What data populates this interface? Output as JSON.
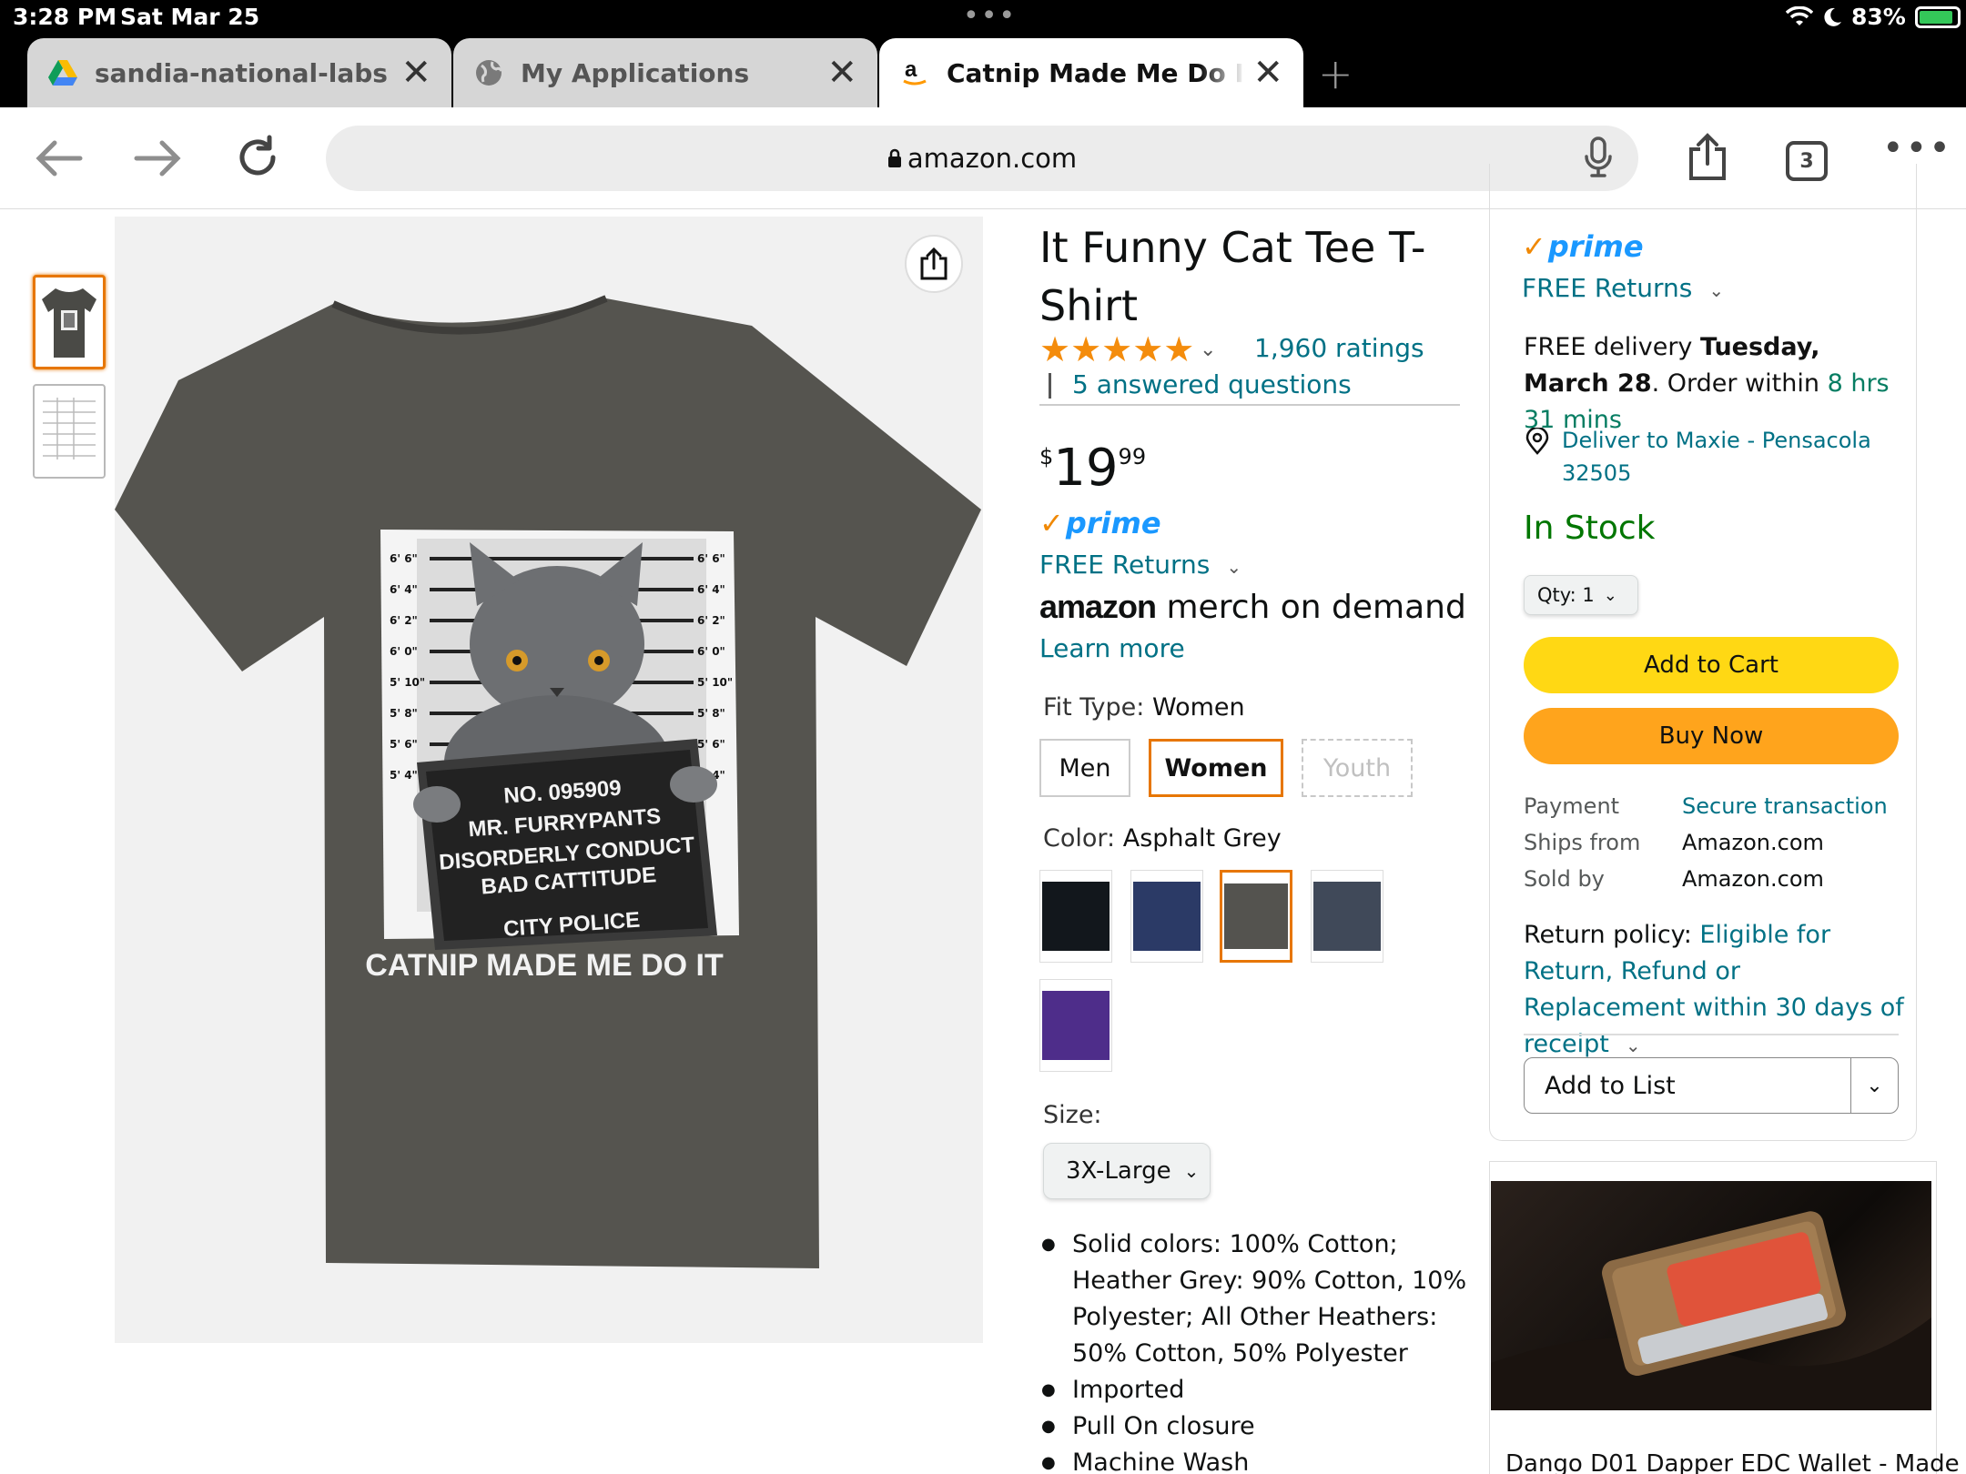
{
  "status_bar": {
    "time": "3:28 PM",
    "date": "Sat Mar 25",
    "dots": "•••",
    "battery": "83%"
  },
  "tabs": [
    {
      "title": "sandia-national-labs - G",
      "close": "✕"
    },
    {
      "title": "My Applications",
      "close": "✕"
    },
    {
      "title": "Catnip Made Me Do It Fu",
      "close": "✕"
    }
  ],
  "new_tab": "+",
  "address": {
    "url": "amazon.com"
  },
  "toolbar": {
    "tab_count": "3"
  },
  "product": {
    "title": "It Funny Cat Tee T-Shirt",
    "stars": "★★★★★",
    "ratings": "1,960 ratings",
    "answered": "5 answered questions",
    "price_symbol": "$",
    "price_whole": "19",
    "price_fraction": "99",
    "prime": "prime",
    "free_returns": "FREE Returns",
    "merch_brand": "amazon",
    "merch_suffix": " merch on demand",
    "learn_more": "Learn more",
    "fit_type_label": "Fit Type:",
    "fit_type_value": "Women",
    "fit_options": [
      "Men",
      "Women",
      "Youth"
    ],
    "color_label": "Color:",
    "color_value": "Asphalt Grey",
    "swatch_colors": {
      "black": "#12171c",
      "navy": "#2b3a66",
      "grey": "#54534f",
      "slate": "#404959",
      "purple": "#4e2d8a"
    },
    "size_label": "Size:",
    "size_value": "3X-Large",
    "bullets": [
      "Solid colors: 100% Cotton; Heather Grey: 90% Cotton, 10% Polyester; All Other Heathers: 50% Cotton, 50% Polyester",
      "Imported",
      "Pull On closure",
      "Machine Wash"
    ]
  },
  "shirt_print": {
    "heights": [
      "6' 6\"",
      "6' 4\"",
      "6' 2\"",
      "6' 0\"",
      "5' 10\"",
      "5' 8\"",
      "5' 6\"",
      "5' 4\""
    ],
    "board_line1": "NO. 095909",
    "board_line2": "MR. FURRYPANTS",
    "board_line3": "DISORDERLY CONDUCT",
    "board_line4": "BAD CATTITUDE",
    "board_line5": "CITY POLICE",
    "slogan": "CATNIP MADE ME DO IT",
    "shirt_color": "#55544f"
  },
  "buybox": {
    "prime": "prime",
    "free_returns": "FREE Returns",
    "delivery_prefix": "FREE delivery ",
    "delivery_date": "Tuesday, March 28",
    "delivery_mid": ". Order within ",
    "delivery_window": "8 hrs 31 mins",
    "deliver_to": "Deliver to Maxie - Pensacola 32505",
    "stock": "In Stock",
    "qty": "Qty:  1",
    "add_to_cart": "Add to Cart",
    "buy_now": "Buy Now",
    "payment_label": "Payment",
    "payment_value": "Secure transaction",
    "ships_label": "Ships from",
    "ships_value": "Amazon.com",
    "sold_label": "Sold by",
    "sold_value": "Amazon.com",
    "return_label": "Return policy: ",
    "return_value": "Eligible for Return, Refund or Replacement within 30 days of receipt",
    "add_to_list": "Add to List"
  },
  "ad": {
    "title": "Dango D01 Dapper EDC Wallet - Made"
  }
}
